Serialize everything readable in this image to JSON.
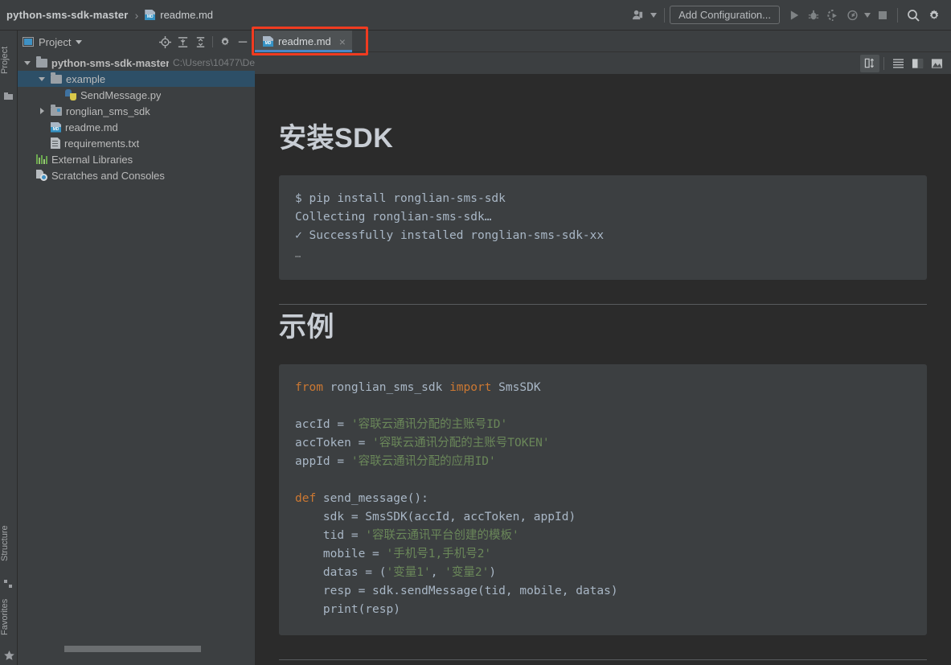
{
  "window": {
    "breadcrumb": {
      "project": "python-sms-sdk-master",
      "separator": "›",
      "file": "readme.md",
      "file_icon": "markdown-file-icon"
    },
    "toolbar_right": {
      "user_icon": "user-account-icon",
      "user_caret": "▾",
      "add_configuration_label": "Add Configuration...",
      "run_icon": "run-icon",
      "debug_icon": "debug-icon",
      "coverage_icon": "run-with-coverage-icon",
      "profile_icon": "profile-icon",
      "profile_caret": "▾",
      "stop_icon": "stop-icon",
      "search_icon": "search-icon",
      "settings_icon": "gear-icon"
    }
  },
  "left_rail": {
    "top_tabs": [
      {
        "label": "Project",
        "icon": "project-tool-icon"
      }
    ],
    "bottom_tabs": [
      {
        "label": "Structure",
        "icon": "structure-tool-icon"
      },
      {
        "label": "Favorites",
        "icon": "star-icon"
      }
    ]
  },
  "project_panel": {
    "title": "Project",
    "title_icon": "project-window-icon",
    "title_caret": "▾",
    "tools": [
      {
        "name": "select-opened-file-icon"
      },
      {
        "name": "expand-all-icon"
      },
      {
        "name": "collapse-all-icon"
      },
      {
        "name": "gear-icon"
      },
      {
        "name": "hide-icon"
      }
    ],
    "tree": [
      {
        "label": "python-sms-sdk-master",
        "path": "C:\\Users\\10477\\De",
        "icon": "folder-icon",
        "twisty": "down",
        "indent": 0,
        "bold": true,
        "selected": false
      },
      {
        "label": "example",
        "path": "",
        "icon": "folder-icon",
        "twisty": "down",
        "indent": 1,
        "bold": false,
        "selected": true
      },
      {
        "label": "SendMessage.py",
        "path": "",
        "icon": "python-file-icon",
        "twisty": "none",
        "indent": 2,
        "bold": false,
        "selected": false
      },
      {
        "label": "ronglian_sms_sdk",
        "path": "",
        "icon": "source-folder-icon",
        "twisty": "right",
        "indent": 1,
        "bold": false,
        "selected": false
      },
      {
        "label": "readme.md",
        "path": "",
        "icon": "markdown-file-icon",
        "twisty": "none",
        "indent": 1,
        "bold": false,
        "selected": false
      },
      {
        "label": "requirements.txt",
        "path": "",
        "icon": "text-file-icon",
        "twisty": "none",
        "indent": 1,
        "bold": false,
        "selected": false
      },
      {
        "label": "External Libraries",
        "path": "",
        "icon": "libraries-icon",
        "twisty": "none",
        "indent": 0,
        "bold": false,
        "selected": false
      },
      {
        "label": "Scratches and Consoles",
        "path": "",
        "icon": "scratches-icon",
        "twisty": "none",
        "indent": 0,
        "bold": false,
        "selected": false
      }
    ]
  },
  "editor": {
    "tab": {
      "label": "readme.md",
      "icon": "markdown-file-icon",
      "close_glyph": "×",
      "highlight_color": "#f03b20",
      "active_underline_color": "#4a88c7"
    },
    "preview_toolbar": [
      {
        "name": "toggle-preview-layout-icon",
        "active": true
      },
      {
        "name": "editor-only-icon",
        "active": false
      },
      {
        "name": "editor-and-preview-icon",
        "active": false
      },
      {
        "name": "preview-only-icon",
        "active": false
      }
    ]
  },
  "preview": {
    "sections": [
      {
        "heading": "安装SDK",
        "code_lines": [
          "$ pip install ronglian-sms-sdk",
          "Collecting ronglian-sms-sdk…",
          "✓ Successfully installed ronglian-sms-sdk-xx",
          "…"
        ]
      },
      {
        "heading": "示例",
        "code_tokens": [
          [
            {
              "t": "from",
              "c": "kw"
            },
            {
              "t": " ronglian_sms_sdk ",
              "c": "plain"
            },
            {
              "t": "import",
              "c": "kw"
            },
            {
              "t": " SmsSDK",
              "c": "plain"
            }
          ],
          [
            {
              "t": "",
              "c": "plain"
            }
          ],
          [
            {
              "t": "accId = ",
              "c": "plain"
            },
            {
              "t": "'容联云通讯分配的主账号ID'",
              "c": "str"
            }
          ],
          [
            {
              "t": "accToken = ",
              "c": "plain"
            },
            {
              "t": "'容联云通讯分配的主账号TOKEN'",
              "c": "str"
            }
          ],
          [
            {
              "t": "appId = ",
              "c": "plain"
            },
            {
              "t": "'容联云通讯分配的应用ID'",
              "c": "str"
            }
          ],
          [
            {
              "t": "",
              "c": "plain"
            }
          ],
          [
            {
              "t": "def",
              "c": "kw"
            },
            {
              "t": " send_message():",
              "c": "plain"
            }
          ],
          [
            {
              "t": "    sdk = SmsSDK(accId, accToken, appId)",
              "c": "plain"
            }
          ],
          [
            {
              "t": "    tid = ",
              "c": "plain"
            },
            {
              "t": "'容联云通讯平台创建的模板'",
              "c": "str"
            }
          ],
          [
            {
              "t": "    mobile = ",
              "c": "plain"
            },
            {
              "t": "'手机号1,手机号2'",
              "c": "str"
            }
          ],
          [
            {
              "t": "    datas = (",
              "c": "plain"
            },
            {
              "t": "'变量1'",
              "c": "str"
            },
            {
              "t": ", ",
              "c": "plain"
            },
            {
              "t": "'变量2'",
              "c": "str"
            },
            {
              "t": ")",
              "c": "plain"
            }
          ],
          [
            {
              "t": "    resp = sdk.sendMessage(tid, mobile, datas)",
              "c": "plain"
            }
          ],
          [
            {
              "t": "    print(resp)",
              "c": "plain"
            }
          ]
        ]
      }
    ]
  },
  "colors": {
    "window_bg": "#3c3f41",
    "editor_bg": "#2b2b2b",
    "code_block_bg": "#3c3f41",
    "selection_blue": "#2d4f67",
    "accent_blue": "#4a88c7",
    "keyword_orange": "#cc7832",
    "string_green": "#6a8759",
    "text_default": "#a9b7c6",
    "heading": "#c8cdd4",
    "annotation_red": "#f03b20"
  }
}
